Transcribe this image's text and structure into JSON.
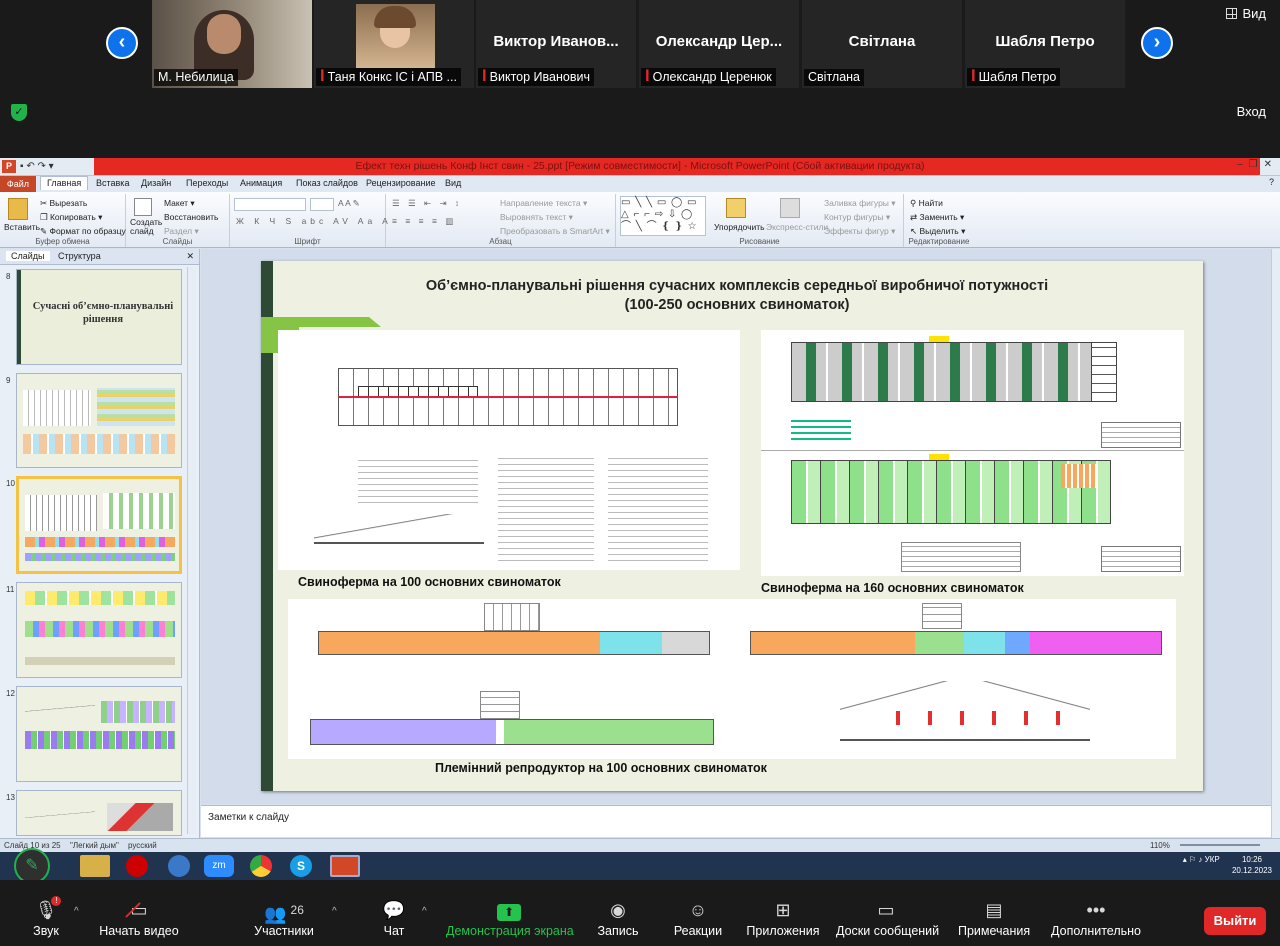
{
  "zoom": {
    "view_label": "Вид",
    "signin_label": "Вход",
    "exit_label": "Выйти",
    "participants": [
      {
        "display": "",
        "label": "М. Небилица",
        "muted": false
      },
      {
        "display": "",
        "label": "Таня Конкс ІС і АПВ ...",
        "muted": true
      },
      {
        "display": "Виктор Иванов...",
        "label": "Виктор Иванович",
        "muted": true
      },
      {
        "display": "Олександр Цер...",
        "label": "Олександр Церенюк",
        "muted": true
      },
      {
        "display": "Світлана",
        "label": "Світлана",
        "muted": false
      },
      {
        "display": "Шабля Петро",
        "label": "Шабля Петро",
        "muted": true
      }
    ],
    "toolbar": {
      "audio": "Звук",
      "video": "Начать видео",
      "participants": "Участники",
      "participants_count": "26",
      "chat": "Чат",
      "share": "Демонстрация экрана",
      "record": "Запись",
      "reactions": "Реакции",
      "apps": "Приложения",
      "whiteboards": "Доски сообщений",
      "notes": "Примечания",
      "more": "Дополнительно"
    }
  },
  "ppt": {
    "window_title": "Ефект техн рішень Конф Інст свин - 25.ppt [Режим совместимости] - Microsoft PowerPoint (Сбой активации продукта)",
    "tabs": [
      "Файл",
      "Главная",
      "Вставка",
      "Дизайн",
      "Переходы",
      "Анимация",
      "Показ слайдов",
      "Рецензирование",
      "Вид"
    ],
    "ribbon": {
      "paste": "Вставить",
      "cut": "Вырезать",
      "copy": "Копировать",
      "format_painter": "Формат по образцу",
      "clipboard_group": "Буфер обмена",
      "new_slide": "Создать слайд",
      "layout": "Макет",
      "reset": "Восстановить",
      "section": "Раздел",
      "slides_group": "Слайды",
      "font_group": "Шрифт",
      "text_direction": "Направление текста",
      "align_text": "Выровнять текст",
      "smartart": "Преобразовать в SmartArt",
      "paragraph_group": "Абзац",
      "arrange": "Упорядочить",
      "quick_styles": "Экспресс-стили",
      "shape_fill": "Заливка фигуры",
      "shape_outline": "Контур фигуры",
      "shape_effects": "Эффекты фигур",
      "drawing_group": "Рисование",
      "find": "Найти",
      "replace": "Заменить",
      "select": "Выделить",
      "editing_group": "Редактирование"
    },
    "pane_tabs": [
      "Слайды",
      "Структура"
    ],
    "thumbs": [
      {
        "num": "8",
        "title": "Сучасні об’ємно-планувальні рішення"
      },
      {
        "num": "9",
        "title": ""
      },
      {
        "num": "10",
        "title": ""
      },
      {
        "num": "11",
        "title": ""
      },
      {
        "num": "12",
        "title": ""
      },
      {
        "num": "13",
        "title": ""
      }
    ],
    "slide": {
      "title": "Об’ємно-планувальні рішення сучасних комплексів середньої виробничої потужності (100-250 основних свиноматок)",
      "caption_100": "Свиноферма  на 100 основних свиноматок",
      "caption_160": "Свиноферма  на 160 основних свиноматок",
      "caption_bottom": "Племінний репродуктор на 100 основних свиноматок"
    },
    "notes_placeholder": "Заметки к слайду",
    "status": {
      "slide_of": "Слайд 10 из 25",
      "theme": "\"Легкий дым\"",
      "language": "русский",
      "zoom": "110%"
    }
  },
  "taskbar": {
    "lang": "УКР",
    "time": "10:26",
    "date": "20.12.2023"
  }
}
